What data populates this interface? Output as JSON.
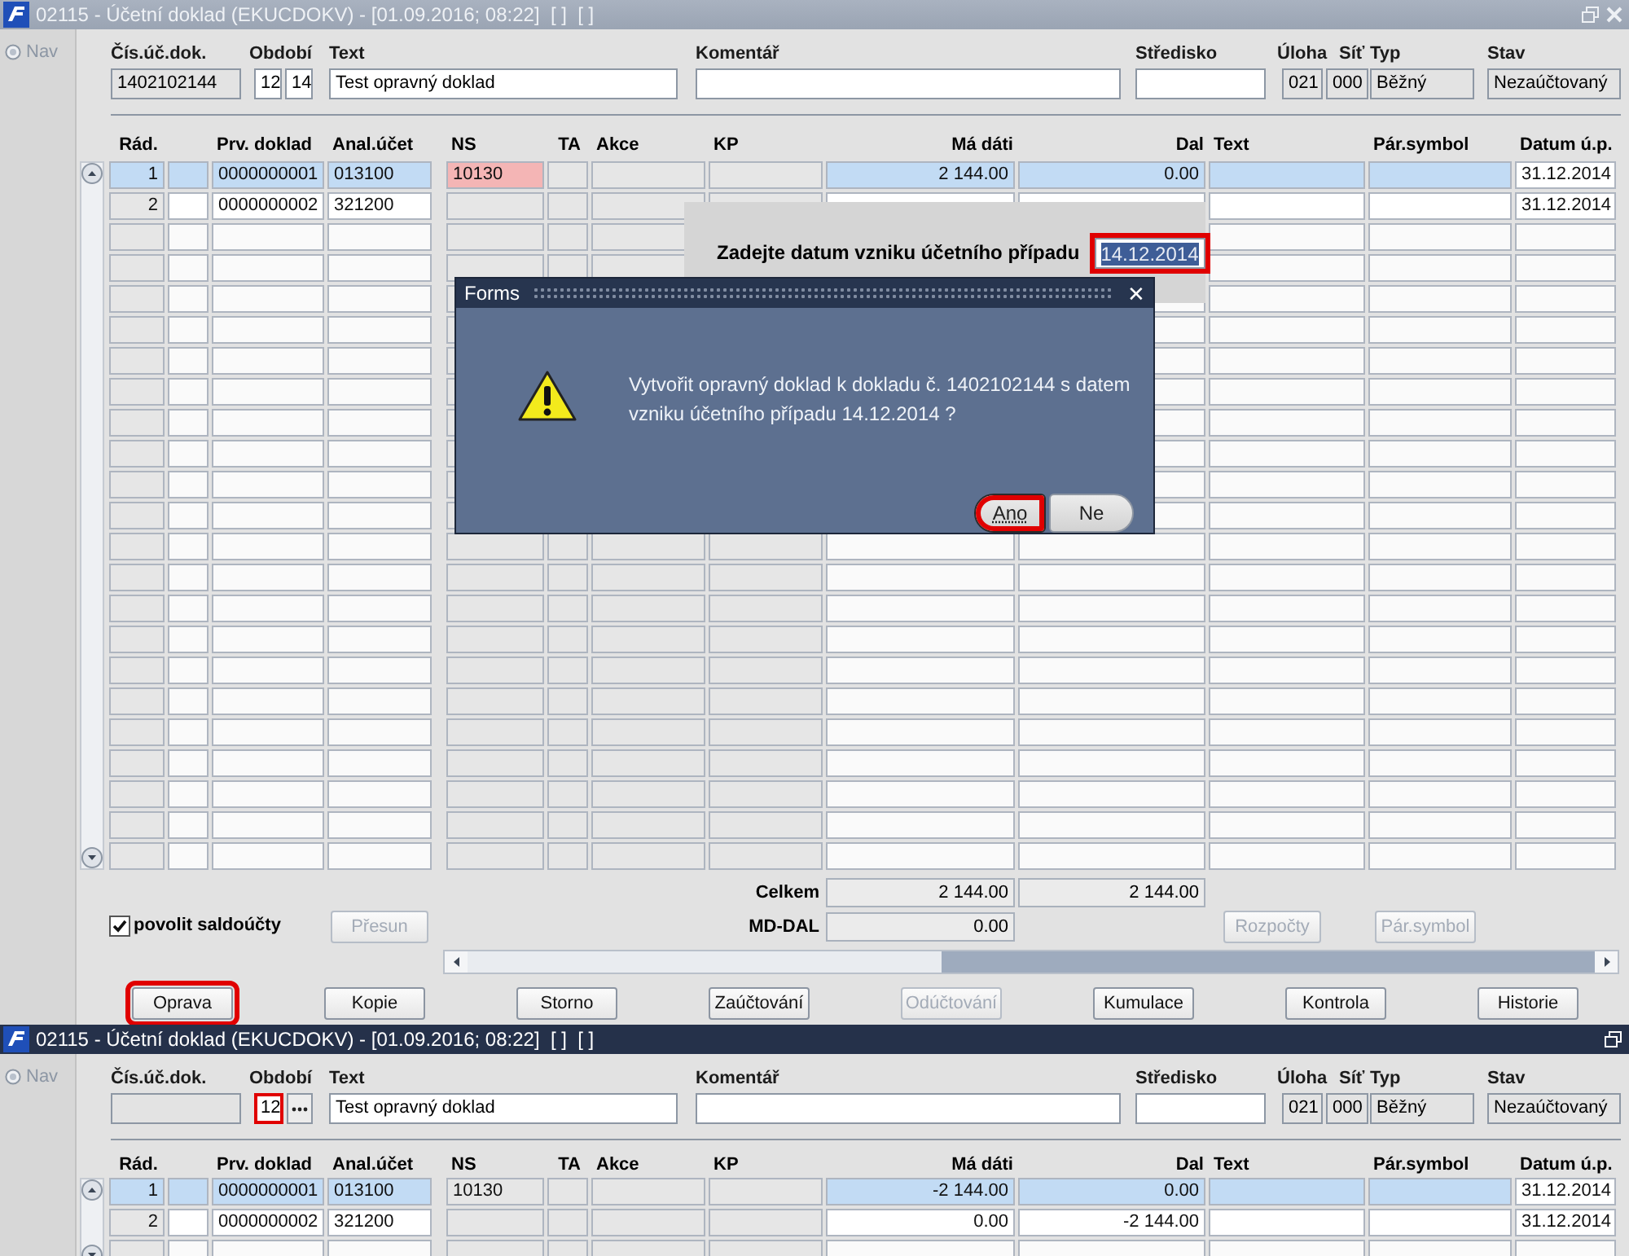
{
  "windows": [
    {
      "title": "02115 - Účetní doklad (EKUCDOKV) - [01.09.2016; 08:22]  [ ]  [ ]",
      "active": false,
      "nav": {
        "label": "Nav",
        "selected": false
      },
      "fields": [
        {
          "label": "Čís.úč.dok.",
          "kind": "text",
          "value": "1402102144",
          "editable": false,
          "highlighted": false
        },
        {
          "label": "Období",
          "kind": "pair",
          "values": [
            "12",
            "14"
          ],
          "editable": true,
          "highlighted": false
        },
        {
          "label": "Text",
          "kind": "text",
          "value": "Test opravný doklad",
          "editable": true,
          "highlighted": false
        },
        {
          "label": "Komentář",
          "kind": "text",
          "editable": true,
          "highlighted": false
        },
        {
          "label": "Středisko",
          "kind": "text",
          "editable": true,
          "highlighted": false
        },
        {
          "label": "Úloha",
          "kind": "text",
          "value": "021",
          "editable": false,
          "highlighted": false
        },
        {
          "label": "Síť",
          "kind": "text",
          "value": "000",
          "editable": false,
          "highlighted": false
        },
        {
          "label": "Typ",
          "kind": "text",
          "value": "Běžný",
          "editable": false,
          "highlighted": false
        },
        {
          "label": "Stav",
          "kind": "text",
          "value": "Nezaúčtovaný",
          "editable": false,
          "highlighted": false
        }
      ],
      "columns": [
        {
          "label": "Rád.",
          "kind": "index"
        },
        {
          "kind": "editable"
        },
        {
          "label": "Prv. doklad",
          "kind": "editable"
        },
        {
          "label": "Anal.účet",
          "kind": "editable"
        },
        {
          "label": "NS",
          "kind": "readonly"
        },
        {
          "label": "TA",
          "kind": "readonly"
        },
        {
          "label": "Akce",
          "kind": "readonly"
        },
        {
          "label": "KP",
          "kind": "readonly"
        },
        {
          "label": "Má dáti",
          "kind": "amount"
        },
        {
          "label": "Dal",
          "kind": "amount"
        },
        {
          "label": "Text",
          "kind": "editable"
        },
        {
          "label": "Pár.symbol",
          "kind": "editable"
        },
        {
          "label": "Datum ú.p.",
          "kind": "date"
        }
      ],
      "rows": [
        {
          "selected": true,
          "flagged": true,
          "cells": [
            "1",
            null,
            "0000000001",
            "013100",
            "10130",
            null,
            null,
            null,
            "2 144.00",
            "0.00",
            null,
            null,
            "31.12.2014"
          ]
        },
        {
          "selected": false,
          "flagged": false,
          "cells": [
            "2",
            null,
            "0000000002",
            "321200",
            null,
            null,
            null,
            null,
            null,
            null,
            null,
            null,
            "31.12.2014"
          ]
        }
      ],
      "footer": {
        "checkbox": {
          "label": "povolit saldoúčty",
          "checked": true
        },
        "move_button": {
          "label": "Přesun",
          "disabled": true
        },
        "totals_label": "Celkem",
        "total_debit": "2 144.00",
        "total_credit": "2 144.00",
        "difference_label": "MD-DAL",
        "difference": "0.00",
        "side_buttons": [
          {
            "label": "Rozpočty",
            "disabled": true
          },
          {
            "label": "Pár.symbol",
            "disabled": true
          }
        ],
        "actions": [
          {
            "label": "Oprava",
            "disabled": false,
            "highlighted": true
          },
          {
            "label": "Kopie",
            "disabled": false,
            "highlighted": false
          },
          {
            "label": "Storno",
            "disabled": false,
            "highlighted": false
          },
          {
            "label": "Zaúčtování",
            "disabled": false,
            "highlighted": false
          },
          {
            "label": "Odúčtování",
            "disabled": true,
            "highlighted": false
          },
          {
            "label": "Kumulace",
            "disabled": false,
            "highlighted": false
          },
          {
            "label": "Kontrola",
            "disabled": false,
            "highlighted": false
          },
          {
            "label": "Historie",
            "disabled": false,
            "highlighted": false
          }
        ]
      }
    },
    {
      "title": "02115 - Účetní doklad (EKUCDOKV) - [01.09.2016; 08:22]  [ ]  [ ]",
      "active": true,
      "nav": {
        "label": "Nav",
        "selected": false
      },
      "fields": [
        {
          "label": "Čís.úč.dok.",
          "kind": "text",
          "editable": false,
          "highlighted": false
        },
        {
          "label": "Období",
          "kind": "lookup",
          "value": "12",
          "editable": true,
          "highlighted": true
        },
        {
          "label": "Text",
          "kind": "text",
          "value": "Test opravný doklad",
          "editable": true,
          "highlighted": false
        },
        {
          "label": "Komentář",
          "kind": "text",
          "editable": true,
          "highlighted": false
        },
        {
          "label": "Středisko",
          "kind": "text",
          "editable": true,
          "highlighted": false
        },
        {
          "label": "Úloha",
          "kind": "text",
          "value": "021",
          "editable": false,
          "highlighted": false
        },
        {
          "label": "Síť",
          "kind": "text",
          "value": "000",
          "editable": false,
          "highlighted": false
        },
        {
          "label": "Typ",
          "kind": "text",
          "value": "Běžný",
          "editable": false,
          "highlighted": false
        },
        {
          "label": "Stav",
          "kind": "text",
          "value": "Nezaúčtovaný",
          "editable": false,
          "highlighted": false
        }
      ],
      "columns": [
        {
          "label": "Rád.",
          "kind": "index"
        },
        {
          "kind": "editable"
        },
        {
          "label": "Prv. doklad",
          "kind": "editable"
        },
        {
          "label": "Anal.účet",
          "kind": "editable"
        },
        {
          "label": "NS",
          "kind": "readonly"
        },
        {
          "label": "TA",
          "kind": "readonly"
        },
        {
          "label": "Akce",
          "kind": "readonly"
        },
        {
          "label": "KP",
          "kind": "readonly"
        },
        {
          "label": "Má dáti",
          "kind": "amount"
        },
        {
          "label": "Dal",
          "kind": "amount"
        },
        {
          "label": "Text",
          "kind": "editable"
        },
        {
          "label": "Pár.symbol",
          "kind": "editable"
        },
        {
          "label": "Datum ú.p.",
          "kind": "date"
        }
      ],
      "rows": [
        {
          "selected": true,
          "flagged": false,
          "cells": [
            "1",
            null,
            "0000000001",
            "013100",
            "10130",
            null,
            null,
            null,
            "-2 144.00",
            "0.00",
            null,
            null,
            "31.12.2014"
          ]
        },
        {
          "selected": false,
          "flagged": false,
          "cells": [
            "2",
            null,
            "0000000002",
            "321200",
            null,
            null,
            null,
            null,
            "0.00",
            "-2 144.00",
            null,
            null,
            "31.12.2014"
          ]
        }
      ]
    }
  ],
  "date_prompt": {
    "label": "Zadejte datum vzniku účetního případu",
    "value": "14.12.2014",
    "highlighted": true
  },
  "dialog": {
    "title": "Forms",
    "close": "✕",
    "message": "Vytvořit opravný doklad k dokladu č. 1402102144 s datem vzniku účetního případu 14.12.2014 ?",
    "buttons": [
      {
        "label": "Ano",
        "focused": true,
        "highlighted": true
      },
      {
        "label": "Ne",
        "focused": false,
        "highlighted": false
      }
    ]
  }
}
